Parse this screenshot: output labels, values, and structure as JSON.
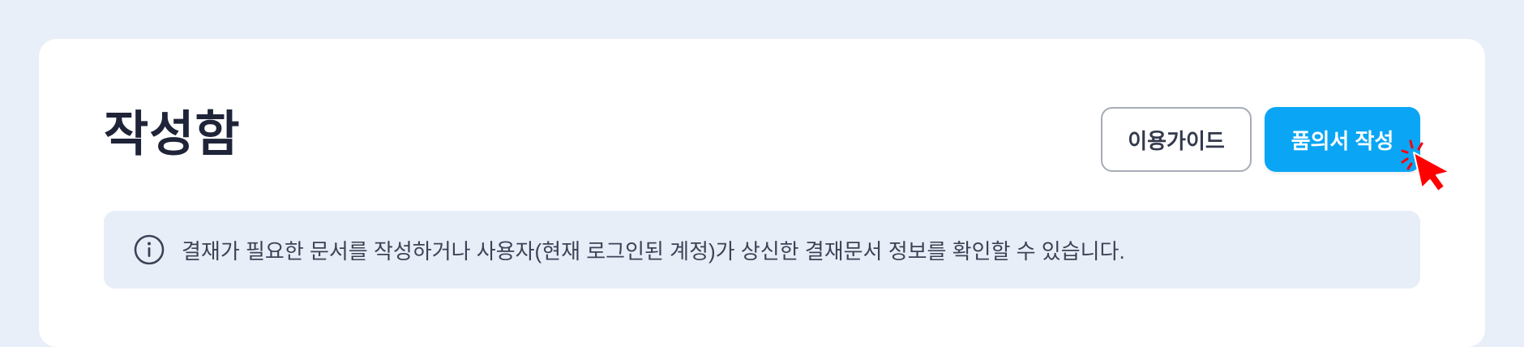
{
  "page": {
    "title": "작성함"
  },
  "toolbar": {
    "guide_label": "이용가이드",
    "write_label": "품의서 작성"
  },
  "info": {
    "icon": "info-circle-icon",
    "text": "결재가 필요한 문서를 작성하거나 사용자(현재 로그인된 계정)가 상신한 결재문서 정보를 확인할 수 있습니다."
  },
  "colors": {
    "background": "#e9eff8",
    "card": "#ffffff",
    "title": "#1f2438",
    "primary_button": "#0aa6f5",
    "info_box": "#e8eef8",
    "cursor": "#ff0000"
  }
}
